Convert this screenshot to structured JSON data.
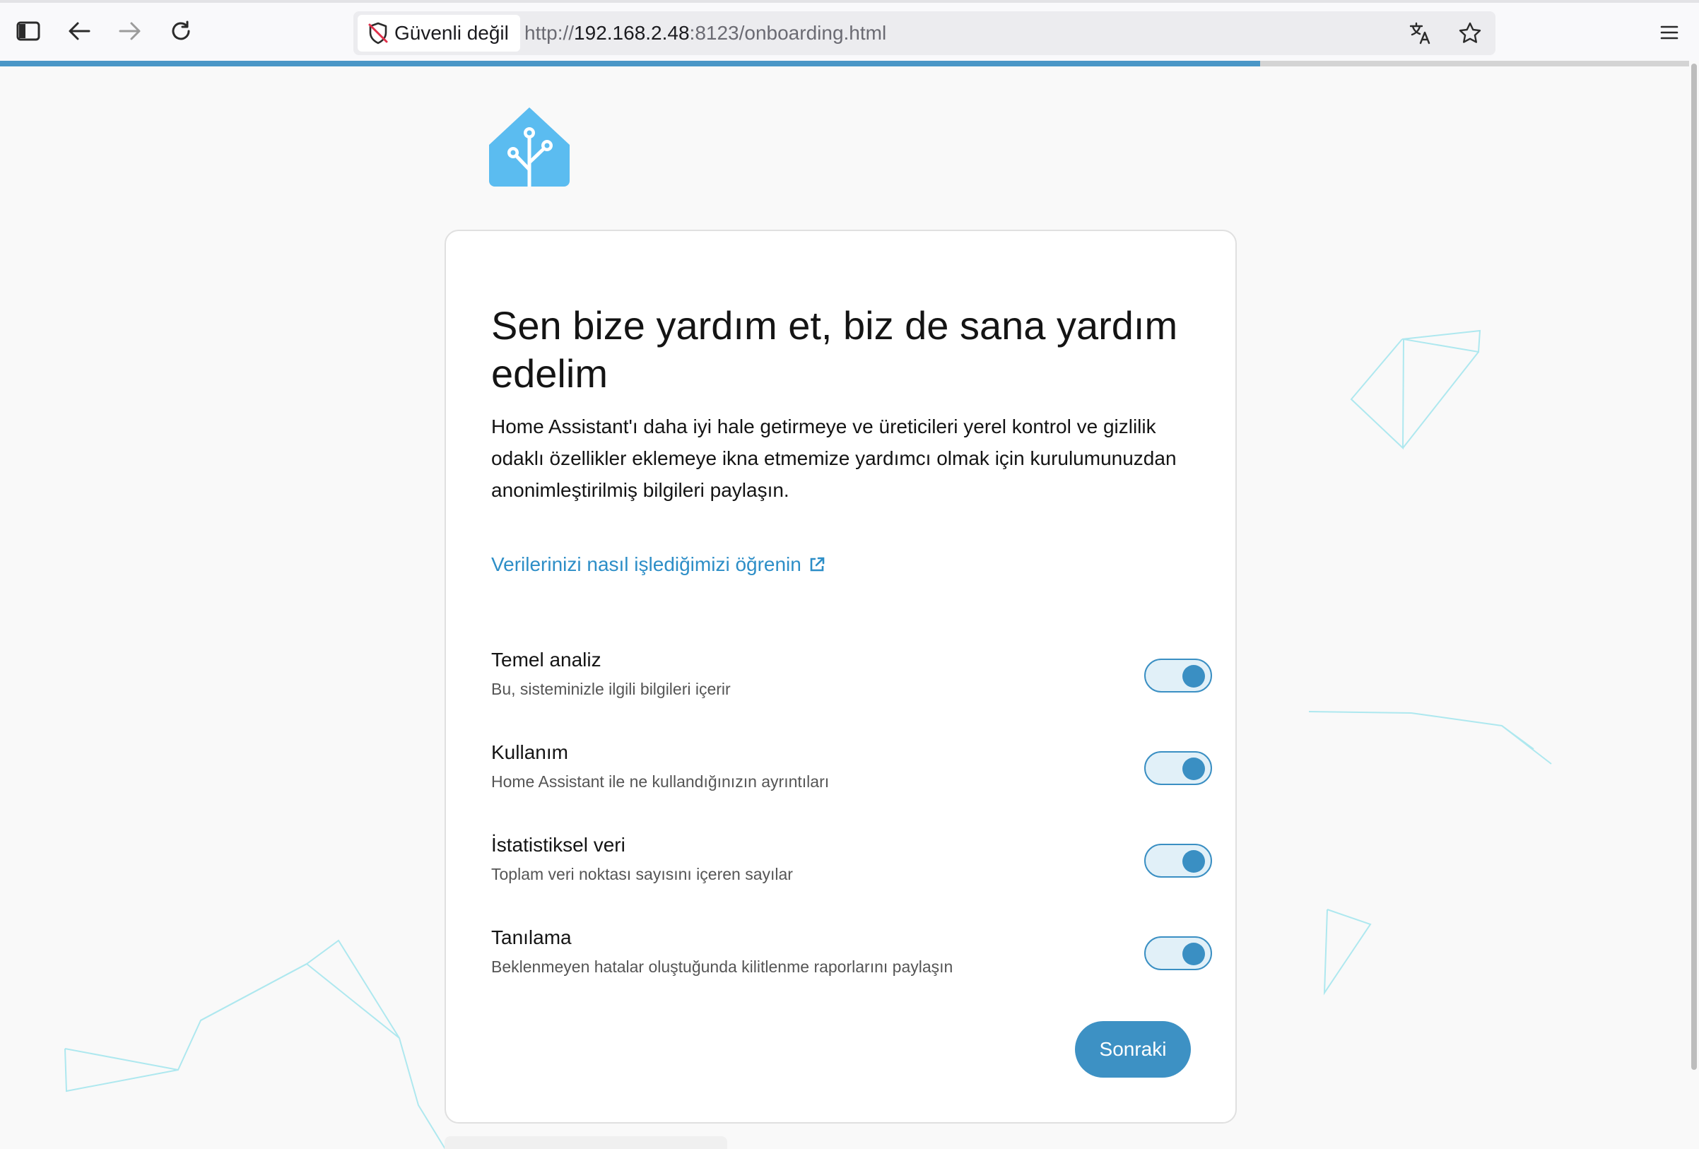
{
  "browser": {
    "security_label": "Güvenli değil",
    "url_scheme": "http://",
    "url_host": "192.168.2.48",
    "url_rest": ":8123/onboarding.html",
    "icons": [
      "sidebar-icon",
      "back-arrow-icon",
      "forward-arrow-icon",
      "reload-icon",
      "shield-slash-icon",
      "translate-icon",
      "star-icon",
      "hamburger-menu-icon"
    ]
  },
  "progress": {
    "percent": 74.6,
    "color": "#4a97c7"
  },
  "card": {
    "title": "Sen bize yardım et, biz de sana yardım edelim",
    "description": "Home Assistant'ı daha iyi hale getirmeye ve üreticileri yerel kontrol ve gizlilik odaklı özellikler eklemeye ikna etmemize yardımcı olmak için kurulumunuzdan anonimleştirilmiş bilgileri paylaşın.",
    "learn_link": "Verilerinizi nasıl işlediğimizi öğrenin",
    "options": [
      {
        "title": "Temel analiz",
        "subtitle": "Bu, sisteminizle ilgili bilgileri içerir",
        "enabled": true
      },
      {
        "title": "Kullanım",
        "subtitle": "Home Assistant ile ne kullandığınızın ayrıntıları",
        "enabled": true
      },
      {
        "title": "İstatistiksel veri",
        "subtitle": "Toplam veri noktası sayısını içeren sayılar",
        "enabled": true
      },
      {
        "title": "Tanılama",
        "subtitle": "Beklenmeyen hatalar oluştuğunda kilitlenme raporlarını paylaşın",
        "enabled": true
      }
    ],
    "next_label": "Sonraki"
  },
  "colors": {
    "accent": "#3d91c4",
    "logo": "#5bbcf0",
    "link": "#2d8ec7"
  }
}
